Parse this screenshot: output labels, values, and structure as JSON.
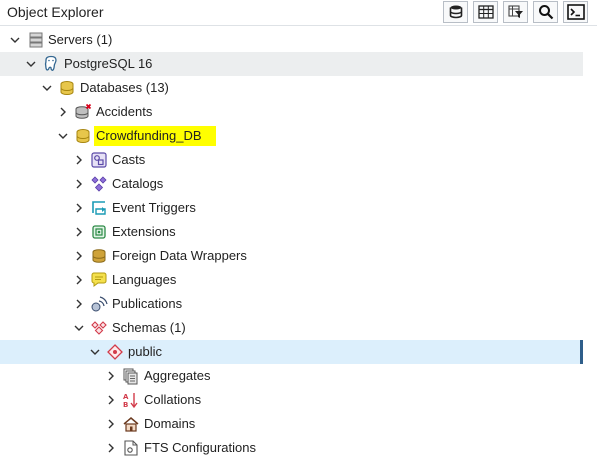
{
  "panel": {
    "title": "Object Explorer"
  },
  "toolbar": {
    "buttons": [
      {
        "name": "query-tool-button",
        "icon": "database-query-icon"
      },
      {
        "name": "view-data-button",
        "icon": "table-grid-icon"
      },
      {
        "name": "filtered-rows-button",
        "icon": "table-filter-icon"
      },
      {
        "name": "search-objects-button",
        "icon": "search-icon"
      },
      {
        "name": "psql-tool-button",
        "icon": "terminal-icon"
      }
    ]
  },
  "tree": {
    "servers": "Servers (1)",
    "server": "PostgreSQL 16",
    "databases": "Databases (13)",
    "db_accidents": "Accidents",
    "db_crowdfunding": "Crowdfunding_DB",
    "casts": "Casts",
    "catalogs": "Catalogs",
    "event_triggers": "Event Triggers",
    "extensions": "Extensions",
    "fdw": "Foreign Data Wrappers",
    "languages": "Languages",
    "publications": "Publications",
    "schemas": "Schemas (1)",
    "schema_public": "public",
    "aggregates": "Aggregates",
    "collations": "Collations",
    "domains": "Domains",
    "fts_configurations": "FTS Configurations"
  },
  "colors": {
    "highlight": "#ffff00",
    "selected_row": "#dceffc",
    "hover_row": "#eceeef",
    "accent_bar": "#2f5e8a"
  }
}
